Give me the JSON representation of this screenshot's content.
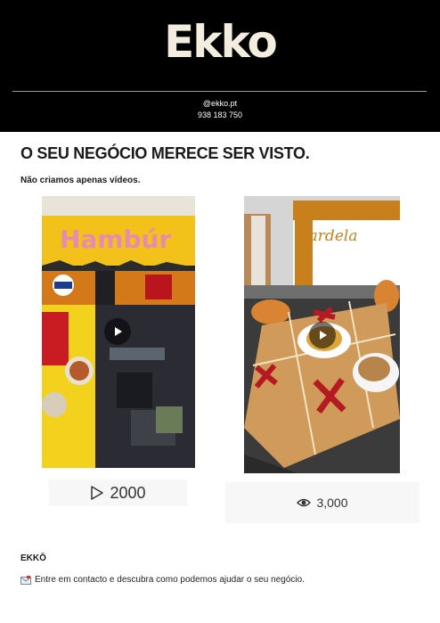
{
  "header": {
    "brand": "Ekko",
    "handle": "@ekko.pt",
    "phone": "938 183 750"
  },
  "main": {
    "headline": "O SEU NEGÓCIO MERECE SER VISTO.",
    "subline": "Não criamos apenas vídeos."
  },
  "videos": [
    {
      "sign_text": "Hambúr",
      "stat_icon": "play-outline-icon",
      "stat": "2000"
    },
    {
      "sign_text": "Pardela",
      "stat_icon": "eye-icon",
      "stat": "3,000"
    }
  ],
  "footer": {
    "title": "EKKŌ",
    "icon": "envelope-icon",
    "text": "Entre em contacto e descubra como podemos ajudar o seu negócio."
  },
  "colors": {
    "header_bg": "#000000",
    "logo": "#f3ede0",
    "stat_bg": "#f7f7f7"
  }
}
